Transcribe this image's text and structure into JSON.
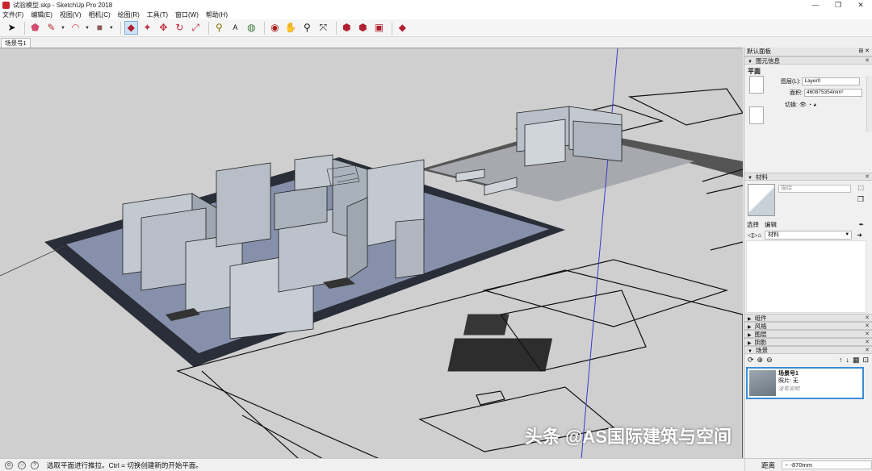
{
  "window": {
    "title": "试验模型.skp - SketchUp Pro 2018",
    "minimize": "—",
    "restore": "❐",
    "close": "✕"
  },
  "menu": [
    "文件(F)",
    "编辑(E)",
    "视图(V)",
    "相机(C)",
    "绘图(R)",
    "工具(T)",
    "窗口(W)",
    "帮助(H)"
  ],
  "toolbar": {
    "icons": [
      "select-icon",
      "eraser-icon",
      "pencil-icon",
      "arc-icon",
      "shape-icon",
      "push-pull-icon",
      "follow-me-icon",
      "move-icon",
      "rotate-icon",
      "scale-icon",
      "tape-measure-icon",
      "text-icon",
      "paint-bucket-icon",
      "orbit-icon",
      "pan-icon",
      "zoom-icon",
      "zoom-extents-icon",
      "3d-warehouse-icon",
      "extension-warehouse-icon",
      "layout-icon",
      "ruby-icon"
    ]
  },
  "scene_tab": "场景号1",
  "tray": {
    "title": "默认面板",
    "pin": "⊞ ✕",
    "entity_info": {
      "header": "图元信息",
      "entity": "平面",
      "layer_label": "图层(L):",
      "layer_value": "Layer0",
      "area_label": "面积:",
      "area_value": "460875354mm²",
      "toggle_label": "切换:"
    },
    "materials": {
      "header": "材料",
      "name_placeholder": "描绘",
      "tab_select": "选择",
      "tab_edit": "编辑",
      "library": "材料"
    },
    "sections": [
      "组件",
      "风格",
      "图层",
      "阴影",
      "场景"
    ],
    "scenes": {
      "name": "场景号1",
      "photo": "照片: 无",
      "desc": "没有说明"
    }
  },
  "status": {
    "message": "选取平面进行推拉。Ctrl = 切换创建新的开始平面。",
    "distance_label": "距离",
    "distance_value": "~ -870mm"
  },
  "watermark": "头条 @AS国际建筑与空间",
  "colors": {
    "accent": "#3a8dd6",
    "floor": "#8690aa",
    "ground": "#cfcfcf"
  }
}
